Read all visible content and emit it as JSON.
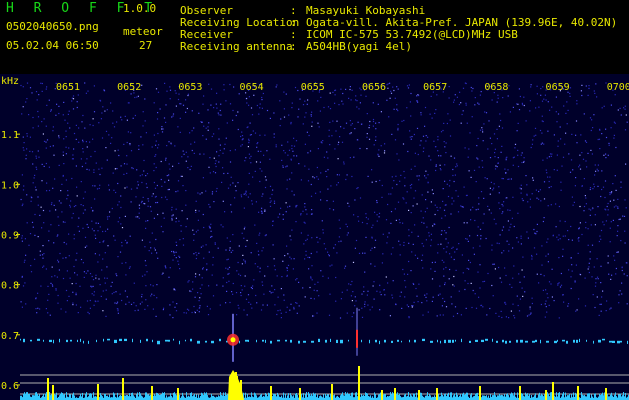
{
  "app": {
    "name": "H R O F F T",
    "version": "1.0.0"
  },
  "file": {
    "name": "0502040650.png",
    "datetime": "05.02.04 06:50"
  },
  "meteor": {
    "label": "meteor",
    "count": "27"
  },
  "info": [
    {
      "key": "Observer",
      "value": "Masayuki Kobayashi"
    },
    {
      "key": "Receiving Location",
      "value": "Ogata-vill. Akita-Pref. JAPAN (139.96E, 40.02N)"
    },
    {
      "key": "Receiver",
      "value": "ICOM IC-575 53.7492(@LCD)MHz USB"
    },
    {
      "key": "Receiving antenna",
      "value": "A504HB(yagi 4el)"
    }
  ],
  "separator": ":",
  "chart_data": {
    "type": "heatmap",
    "ylabel": "kHz",
    "x_ticks": [
      "0651",
      "0652",
      "0653",
      "0654",
      "0655",
      "0656",
      "0657",
      "0658",
      "0659",
      "0700"
    ],
    "y_ticks": [
      "1.1",
      "1.0",
      "0.9",
      "0.8",
      "0.7",
      "0.6"
    ],
    "y_values": [
      1.1,
      1.0,
      0.9,
      0.8,
      0.7,
      0.6
    ],
    "ylim": [
      0.57,
      1.2
    ],
    "carrier_khz": 0.69,
    "meteor_echoes": [
      {
        "time": "06:53:5",
        "khz": 0.69,
        "strength": "strong"
      },
      {
        "time": "06:55:8",
        "khz": 0.69,
        "strength": "medium"
      }
    ],
    "colors": {
      "background": "#000040",
      "noise": "#3030c8",
      "carrier": "#30c8ff",
      "signal": "#ffff00",
      "strong": "#ff3030"
    }
  }
}
